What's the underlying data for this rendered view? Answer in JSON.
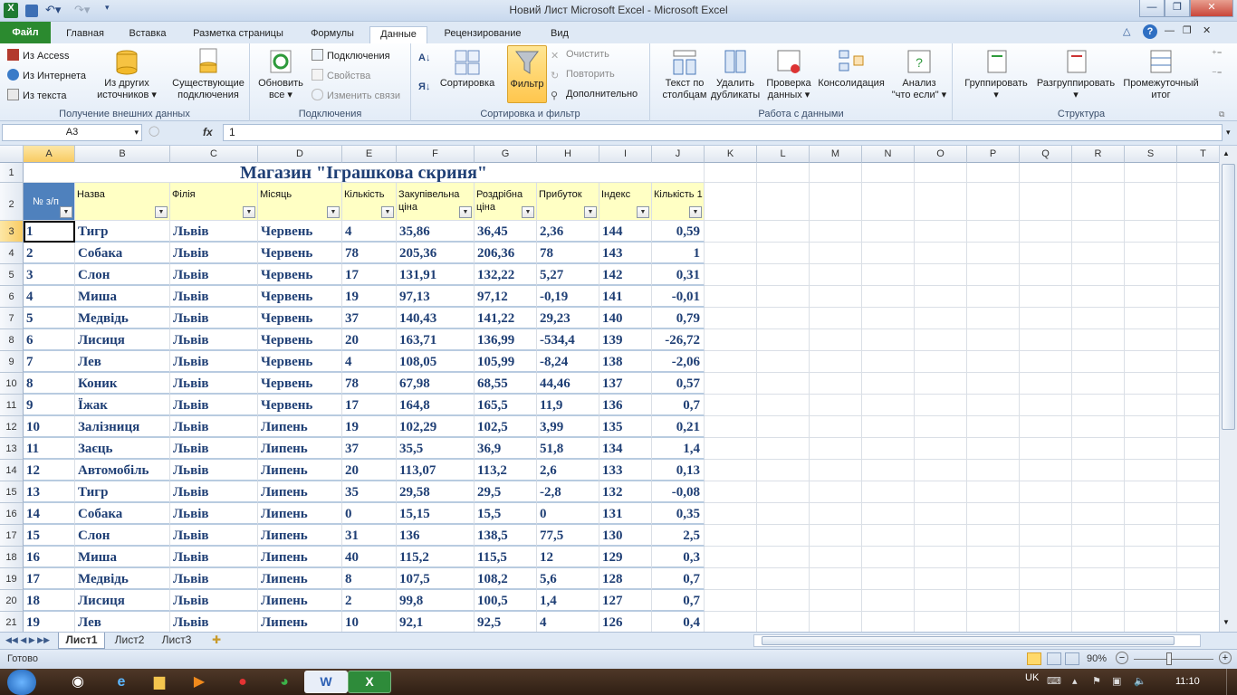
{
  "window": {
    "title": "Новий Лист Microsoft Excel  -  Microsoft Excel"
  },
  "tabs": [
    {
      "label": "Файл"
    },
    {
      "label": "Главная"
    },
    {
      "label": "Вставка"
    },
    {
      "label": "Разметка страницы"
    },
    {
      "label": "Формулы"
    },
    {
      "label": "Данные"
    },
    {
      "label": "Рецензирование"
    },
    {
      "label": "Вид"
    }
  ],
  "ribbon": {
    "get_external": {
      "label": "Получение внешних данных",
      "from_access": "Из Access",
      "from_web": "Из Интернета",
      "from_text": "Из текста",
      "from_other_1": "Из других",
      "from_other_2": "источников",
      "existing_1": "Существующие",
      "existing_2": "подключения"
    },
    "connections": {
      "label": "Подключения",
      "refresh_1": "Обновить",
      "refresh_2": "все",
      "connections": "Подключения",
      "properties": "Свойства",
      "edit_links": "Изменить связи"
    },
    "sort_filter": {
      "label": "Сортировка и фильтр",
      "sort": "Сортировка",
      "filter": "Фильтр",
      "clear": "Очистить",
      "reapply": "Повторить",
      "advanced": "Дополнительно"
    },
    "data_tools": {
      "label": "Работа с данными",
      "text_to_cols_1": "Текст по",
      "text_to_cols_2": "столбцам",
      "remove_dup_1": "Удалить",
      "remove_dup_2": "дубликаты",
      "validation_1": "Проверка",
      "validation_2": "данных",
      "consolidate": "Консолидация",
      "whatif_1": "Анализ",
      "whatif_2": "\"что если\""
    },
    "outline": {
      "label": "Структура",
      "group": "Группировать",
      "ungroup": "Разгруппировать",
      "subtotal_1": "Промежуточный",
      "subtotal_2": "итог"
    }
  },
  "formula_bar": {
    "name_box": "A3",
    "fx": "fx",
    "value": "1"
  },
  "columns": [
    "A",
    "B",
    "C",
    "D",
    "E",
    "F",
    "G",
    "H",
    "I",
    "J",
    "K",
    "L",
    "M",
    "N",
    "O",
    "P",
    "Q",
    "R",
    "S",
    "T"
  ],
  "sheet": {
    "title": "Магазин \"Іграшкова скриня\"",
    "headers": [
      "№ з/п",
      "Назва",
      "Філія",
      "Місяць",
      "Кількість",
      "Закупівельна ціна",
      "Роздрібна ціна",
      "Прибуток",
      "Індекс",
      "Кількість 1"
    ],
    "rows": [
      [
        "1",
        "Тигр",
        "Львів",
        "Червень",
        "4",
        "35,86",
        "36,45",
        "2,36",
        "144",
        "0,59"
      ],
      [
        "2",
        "Собака",
        "Львів",
        "Червень",
        "78",
        "205,36",
        "206,36",
        "78",
        "143",
        "1"
      ],
      [
        "3",
        "Слон",
        "Львів",
        "Червень",
        "17",
        "131,91",
        "132,22",
        "5,27",
        "142",
        "0,31"
      ],
      [
        "4",
        "Миша",
        "Львів",
        "Червень",
        "19",
        "97,13",
        "97,12",
        "-0,19",
        "141",
        "-0,01"
      ],
      [
        "5",
        "Медвідь",
        "Львів",
        "Червень",
        "37",
        "140,43",
        "141,22",
        "29,23",
        "140",
        "0,79"
      ],
      [
        "6",
        "Лисиця",
        "Львів",
        "Червень",
        "20",
        "163,71",
        "136,99",
        "-534,4",
        "139",
        "-26,72"
      ],
      [
        "7",
        "Лев",
        "Львів",
        "Червень",
        "4",
        "108,05",
        "105,99",
        "-8,24",
        "138",
        "-2,06"
      ],
      [
        "8",
        "Коник",
        "Львів",
        "Червень",
        "78",
        "67,98",
        "68,55",
        "44,46",
        "137",
        "0,57"
      ],
      [
        "9",
        "Їжак",
        "Львів",
        "Червень",
        "17",
        "164,8",
        "165,5",
        "11,9",
        "136",
        "0,7"
      ],
      [
        "10",
        "Залізниця",
        "Львів",
        "Липень",
        "19",
        "102,29",
        "102,5",
        "3,99",
        "135",
        "0,21"
      ],
      [
        "11",
        "Заєць",
        "Львів",
        "Липень",
        "37",
        "35,5",
        "36,9",
        "51,8",
        "134",
        "1,4"
      ],
      [
        "12",
        "Автомобіль",
        "Львів",
        "Липень",
        "20",
        "113,07",
        "113,2",
        "2,6",
        "133",
        "0,13"
      ],
      [
        "13",
        "Тигр",
        "Львів",
        "Липень",
        "35",
        "29,58",
        "29,5",
        "-2,8",
        "132",
        "-0,08"
      ],
      [
        "14",
        "Собака",
        "Львів",
        "Липень",
        "0",
        "15,15",
        "15,5",
        "0",
        "131",
        "0,35"
      ],
      [
        "15",
        "Слон",
        "Львів",
        "Липень",
        "31",
        "136",
        "138,5",
        "77,5",
        "130",
        "2,5"
      ],
      [
        "16",
        "Миша",
        "Львів",
        "Липень",
        "40",
        "115,2",
        "115,5",
        "12",
        "129",
        "0,3"
      ],
      [
        "17",
        "Медвідь",
        "Львів",
        "Липень",
        "8",
        "107,5",
        "108,2",
        "5,6",
        "128",
        "0,7"
      ],
      [
        "18",
        "Лисиця",
        "Львів",
        "Липень",
        "2",
        "99,8",
        "100,5",
        "1,4",
        "127",
        "0,7"
      ],
      [
        "19",
        "Лев",
        "Львів",
        "Липень",
        "10",
        "92,1",
        "92,5",
        "4",
        "126",
        "0,4"
      ]
    ]
  },
  "sheet_tabs": [
    "Лист1",
    "Лист2",
    "Лист3"
  ],
  "status": {
    "ready": "Готово",
    "zoom": "90%"
  },
  "taskbar": {
    "lang": "UK",
    "time": "11:10"
  }
}
